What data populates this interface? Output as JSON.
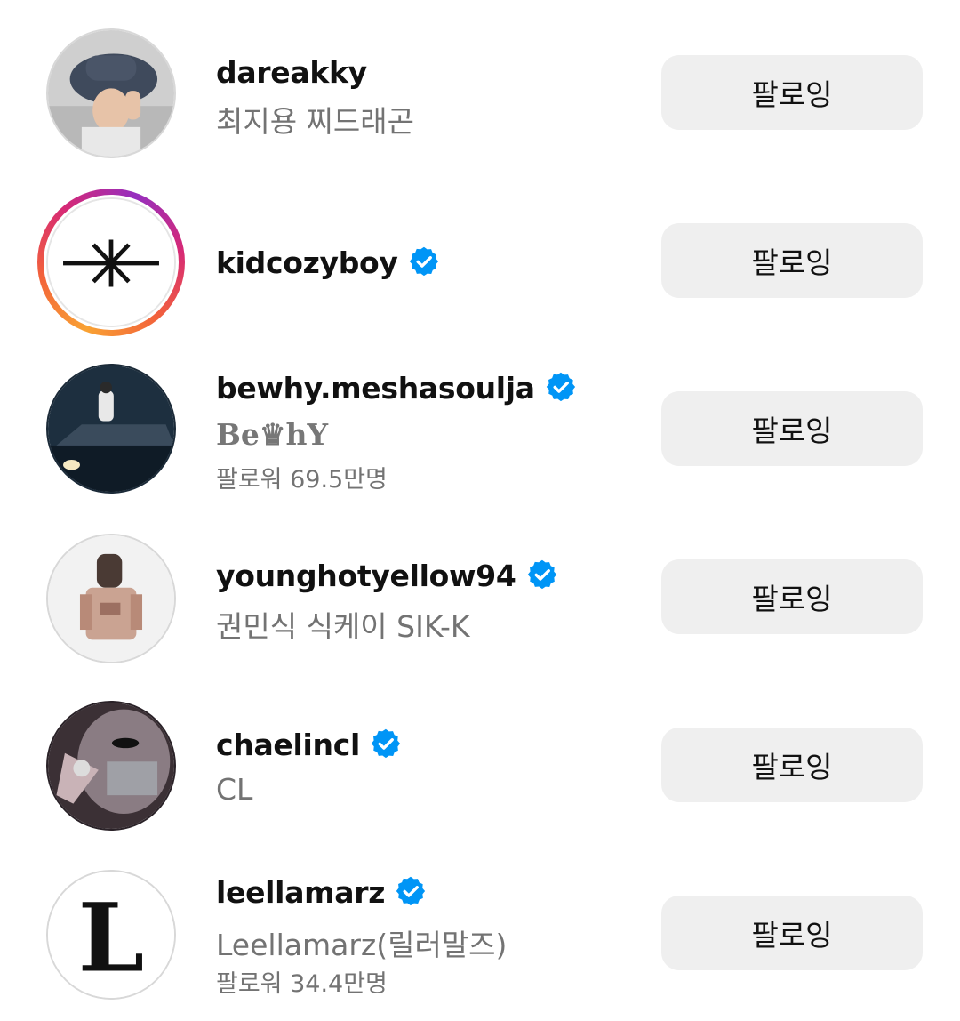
{
  "accounts": [
    {
      "username": "dareakky",
      "verified": false,
      "full_name": "최지용 찌드래곤",
      "followers": "",
      "button_label": "팔로잉",
      "story_ring": false
    },
    {
      "username": "kidcozyboy",
      "verified": true,
      "full_name": "",
      "followers": "",
      "button_label": "팔로잉",
      "story_ring": true
    },
    {
      "username": "bewhy.meshasoulja",
      "verified": true,
      "full_name": "Be♛hY",
      "followers": "팔로워 69.5만명",
      "button_label": "팔로잉",
      "story_ring": false
    },
    {
      "username": "younghotyellow94",
      "verified": true,
      "full_name": "권민식 식케이 SIK-K",
      "followers": "",
      "button_label": "팔로잉",
      "story_ring": false
    },
    {
      "username": "chaelincl",
      "verified": true,
      "full_name": "CL",
      "followers": "",
      "button_label": "팔로잉",
      "story_ring": false
    },
    {
      "username": "leellamarz",
      "verified": true,
      "full_name": "Leellamarz(릴러말즈)",
      "followers": "팔로워 34.4만명",
      "button_label": "팔로잉",
      "story_ring": false
    }
  ],
  "colors": {
    "verified_badge": "#0095f6",
    "button_bg": "#efefef",
    "secondary_text": "#737373"
  },
  "icons": {
    "verified": "verified-badge-icon"
  }
}
